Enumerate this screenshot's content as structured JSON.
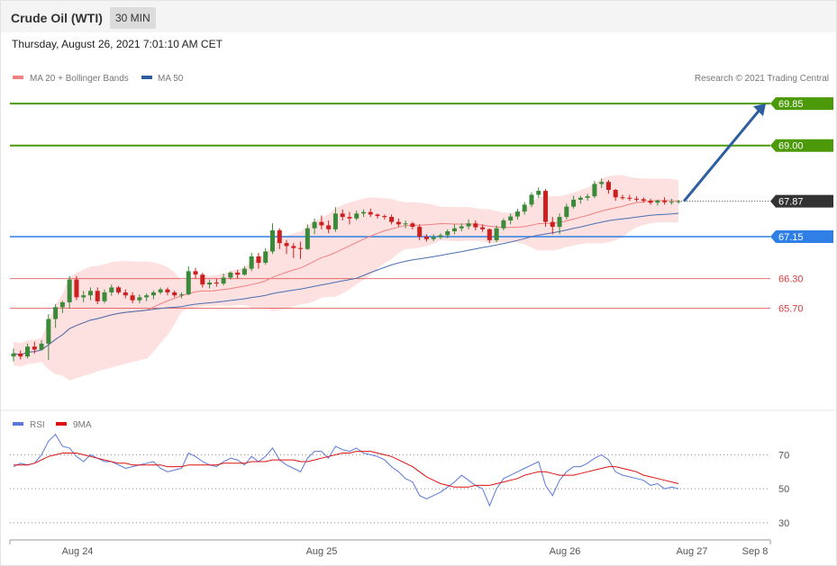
{
  "header": {
    "title": "Crude Oil (WTI)",
    "interval": "30 MIN",
    "timestamp": "Thursday, August 26, 2021 7:01:10 AM CET"
  },
  "legend": {
    "ma20": "MA 20 + Bollinger Bands",
    "ma50": "MA 50",
    "credit": "Research © 2021 Trading Central",
    "rsi": "RSI",
    "rsi_ma": "9MA"
  },
  "colors": {
    "up": "#3a8a3a",
    "down": "#cc1f1f",
    "ma20": "#f08080",
    "ma50": "#4a6fb0",
    "band": "#fde0e0",
    "target": "#4c9a0a",
    "pivot": "#2f7fe6",
    "support": "#d93a3a",
    "arrow": "#2c5ea0",
    "rsi": "#5a78d8",
    "rsi_ma": "#dd1111"
  },
  "chart_data": [
    {
      "type": "candlestick",
      "ylim": [
        63.7,
        70.2
      ],
      "levels": [
        {
          "value": 69.85,
          "label": "69.85",
          "kind": "target"
        },
        {
          "value": 69.0,
          "label": "69.00",
          "kind": "target"
        },
        {
          "value": 67.87,
          "label": "67.87",
          "kind": "last"
        },
        {
          "value": 67.15,
          "label": "67.15",
          "kind": "pivot"
        },
        {
          "value": 66.3,
          "label": "66.30",
          "kind": "support"
        },
        {
          "value": 65.7,
          "label": "65.70",
          "kind": "support"
        }
      ],
      "candles": [
        [
          64.72,
          64.88,
          64.62,
          64.78
        ],
        [
          64.78,
          64.84,
          64.66,
          64.72
        ],
        [
          64.72,
          64.98,
          64.68,
          64.92
        ],
        [
          64.92,
          65.02,
          64.78,
          64.86
        ],
        [
          64.86,
          65.05,
          64.84,
          64.98
        ],
        [
          64.98,
          65.58,
          64.65,
          65.48
        ],
        [
          65.48,
          65.78,
          65.3,
          65.72
        ],
        [
          65.72,
          65.85,
          65.6,
          65.82
        ],
        [
          65.82,
          66.35,
          65.7,
          66.28
        ],
        [
          66.28,
          66.35,
          65.86,
          65.92
        ],
        [
          65.92,
          66.05,
          65.82,
          65.96
        ],
        [
          65.96,
          66.12,
          65.86,
          66.05
        ],
        [
          66.05,
          66.12,
          65.78,
          65.84
        ],
        [
          65.84,
          66.08,
          65.8,
          66.02
        ],
        [
          66.02,
          66.18,
          65.95,
          66.12
        ],
        [
          66.12,
          66.15,
          65.98,
          66.02
        ],
        [
          66.02,
          66.08,
          65.9,
          65.96
        ],
        [
          65.96,
          66.02,
          65.8,
          65.86
        ],
        [
          65.86,
          65.98,
          65.8,
          65.92
        ],
        [
          65.92,
          66.0,
          65.84,
          65.96
        ],
        [
          65.96,
          66.06,
          65.88,
          66.02
        ],
        [
          66.02,
          66.12,
          65.98,
          66.08
        ],
        [
          66.08,
          66.12,
          65.96,
          66.02
        ],
        [
          66.02,
          66.06,
          65.92,
          65.96
        ],
        [
          65.96,
          66.02,
          65.9,
          65.98
        ],
        [
          65.98,
          66.55,
          65.96,
          66.45
        ],
        [
          66.45,
          66.52,
          66.3,
          66.38
        ],
        [
          66.38,
          66.42,
          66.12,
          66.18
        ],
        [
          66.18,
          66.28,
          66.1,
          66.22
        ],
        [
          66.22,
          66.3,
          66.14,
          66.2
        ],
        [
          66.2,
          66.4,
          66.16,
          66.32
        ],
        [
          66.32,
          66.45,
          66.28,
          66.42
        ],
        [
          66.42,
          66.48,
          66.3,
          66.38
        ],
        [
          66.38,
          66.55,
          66.36,
          66.5
        ],
        [
          66.5,
          66.82,
          66.45,
          66.75
        ],
        [
          66.75,
          66.82,
          66.5,
          66.62
        ],
        [
          66.62,
          66.92,
          66.58,
          66.85
        ],
        [
          66.85,
          67.42,
          66.8,
          67.28
        ],
        [
          67.28,
          67.32,
          66.9,
          67.02
        ],
        [
          67.02,
          67.08,
          66.8,
          66.96
        ],
        [
          66.96,
          67.02,
          66.72,
          66.92
        ],
        [
          66.92,
          67.05,
          66.7,
          66.9
        ],
        [
          66.9,
          67.4,
          66.88,
          67.32
        ],
        [
          67.32,
          67.52,
          67.2,
          67.45
        ],
        [
          67.45,
          67.58,
          67.3,
          67.38
        ],
        [
          67.38,
          67.48,
          67.22,
          67.3
        ],
        [
          67.3,
          67.75,
          67.25,
          67.62
        ],
        [
          67.62,
          67.7,
          67.48,
          67.55
        ],
        [
          67.55,
          67.65,
          67.4,
          67.52
        ],
        [
          67.52,
          67.68,
          67.48,
          67.62
        ],
        [
          67.62,
          67.7,
          67.55,
          67.65
        ],
        [
          67.65,
          67.72,
          67.55,
          67.6
        ],
        [
          67.6,
          67.62,
          67.52,
          67.57
        ],
        [
          67.57,
          67.6,
          67.5,
          67.55
        ],
        [
          67.55,
          67.6,
          67.4,
          67.45
        ],
        [
          67.45,
          67.52,
          67.35,
          67.4
        ],
        [
          67.4,
          67.48,
          67.32,
          67.42
        ],
        [
          67.42,
          67.45,
          67.3,
          67.35
        ],
        [
          67.35,
          67.4,
          67.08,
          67.15
        ],
        [
          67.15,
          67.2,
          67.05,
          67.1
        ],
        [
          67.1,
          67.2,
          67.06,
          67.14
        ],
        [
          67.14,
          67.22,
          67.1,
          67.18
        ],
        [
          67.18,
          67.3,
          67.12,
          67.26
        ],
        [
          67.26,
          67.4,
          67.2,
          67.32
        ],
        [
          67.32,
          67.42,
          67.26,
          67.36
        ],
        [
          67.36,
          67.5,
          67.3,
          67.42
        ],
        [
          67.42,
          67.48,
          67.28,
          67.34
        ],
        [
          67.34,
          67.4,
          67.25,
          67.3
        ],
        [
          67.3,
          67.32,
          67.02,
          67.08
        ],
        [
          67.08,
          67.38,
          67.04,
          67.32
        ],
        [
          67.32,
          67.52,
          67.28,
          67.48
        ],
        [
          67.48,
          67.62,
          67.4,
          67.56
        ],
        [
          67.56,
          67.72,
          67.5,
          67.66
        ],
        [
          67.66,
          67.85,
          67.6,
          67.8
        ],
        [
          67.8,
          68.05,
          67.75,
          68.0
        ],
        [
          68.0,
          68.15,
          67.94,
          68.08
        ],
        [
          68.08,
          68.12,
          67.35,
          67.45
        ],
        [
          67.45,
          67.55,
          67.2,
          67.35
        ],
        [
          67.35,
          67.62,
          67.2,
          67.55
        ],
        [
          67.55,
          67.82,
          67.5,
          67.76
        ],
        [
          67.76,
          67.98,
          67.72,
          67.9
        ],
        [
          67.9,
          67.98,
          67.82,
          67.94
        ],
        [
          67.94,
          68.02,
          67.88,
          67.97
        ],
        [
          67.97,
          68.28,
          67.93,
          68.22
        ],
        [
          68.22,
          68.33,
          68.14,
          68.26
        ],
        [
          68.26,
          68.3,
          68.02,
          68.1
        ],
        [
          68.1,
          68.12,
          67.88,
          67.95
        ],
        [
          67.95,
          68.0,
          67.9,
          67.94
        ],
        [
          67.94,
          68.0,
          67.88,
          67.92
        ],
        [
          67.92,
          67.97,
          67.86,
          67.91
        ],
        [
          67.91,
          67.95,
          67.84,
          67.88
        ],
        [
          67.88,
          67.92,
          67.8,
          67.84
        ],
        [
          67.84,
          67.9,
          67.78,
          67.88
        ],
        [
          67.88,
          67.95,
          67.8,
          67.85
        ],
        [
          67.85,
          67.92,
          67.8,
          67.86
        ],
        [
          67.86,
          67.9,
          67.82,
          67.87
        ]
      ]
    },
    {
      "type": "line",
      "ylim": [
        22,
        93
      ],
      "series": [
        {
          "name": "RSI",
          "values": [
            63,
            65,
            64,
            65,
            70,
            78,
            82,
            75,
            74,
            69,
            66,
            70,
            68,
            66,
            66,
            64,
            62,
            63,
            64,
            65,
            66,
            62,
            60,
            61,
            62,
            71,
            69,
            66,
            64,
            63,
            66,
            68,
            67,
            64,
            69,
            66,
            69,
            74,
            67,
            64,
            62,
            60,
            68,
            72,
            72,
            68,
            75,
            73,
            72,
            74,
            71,
            70,
            69,
            67,
            63,
            60,
            56,
            54,
            46,
            44,
            46,
            48,
            51,
            54,
            58,
            55,
            52,
            50,
            40,
            50,
            56,
            58,
            60,
            62,
            64,
            66,
            52,
            46,
            55,
            60,
            63,
            63,
            65,
            68,
            70,
            67,
            60,
            58,
            57,
            56,
            55,
            52,
            53,
            50,
            51,
            50
          ]
        },
        {
          "name": "9MA",
          "values": [
            64,
            64,
            64,
            65,
            67,
            69,
            70,
            71,
            71,
            71,
            70,
            69,
            68,
            67,
            66,
            65,
            65,
            64,
            64,
            64,
            64,
            64,
            63,
            63,
            63,
            64,
            64,
            64,
            64,
            64,
            65,
            65,
            65,
            65,
            66,
            66,
            66,
            67,
            67,
            67,
            67,
            66,
            66,
            67,
            68,
            69,
            70,
            71,
            71,
            72,
            72,
            72,
            71,
            70,
            69,
            67,
            65,
            63,
            60,
            57,
            55,
            53,
            52,
            51,
            51,
            51,
            52,
            52,
            52,
            53,
            54,
            55,
            56,
            58,
            59,
            60,
            60,
            59,
            58,
            58,
            58,
            59,
            60,
            61,
            62,
            63,
            63,
            62,
            61,
            60,
            58,
            57,
            56,
            55,
            54,
            53
          ]
        }
      ],
      "ticks": [
        "70",
        "50",
        "30"
      ],
      "ref_lines": [
        70,
        50,
        30
      ]
    }
  ],
  "xaxis": {
    "labels": [
      "Aug 24",
      "Aug 25",
      "Aug 26",
      "Aug 27",
      "Sep 8"
    ]
  }
}
